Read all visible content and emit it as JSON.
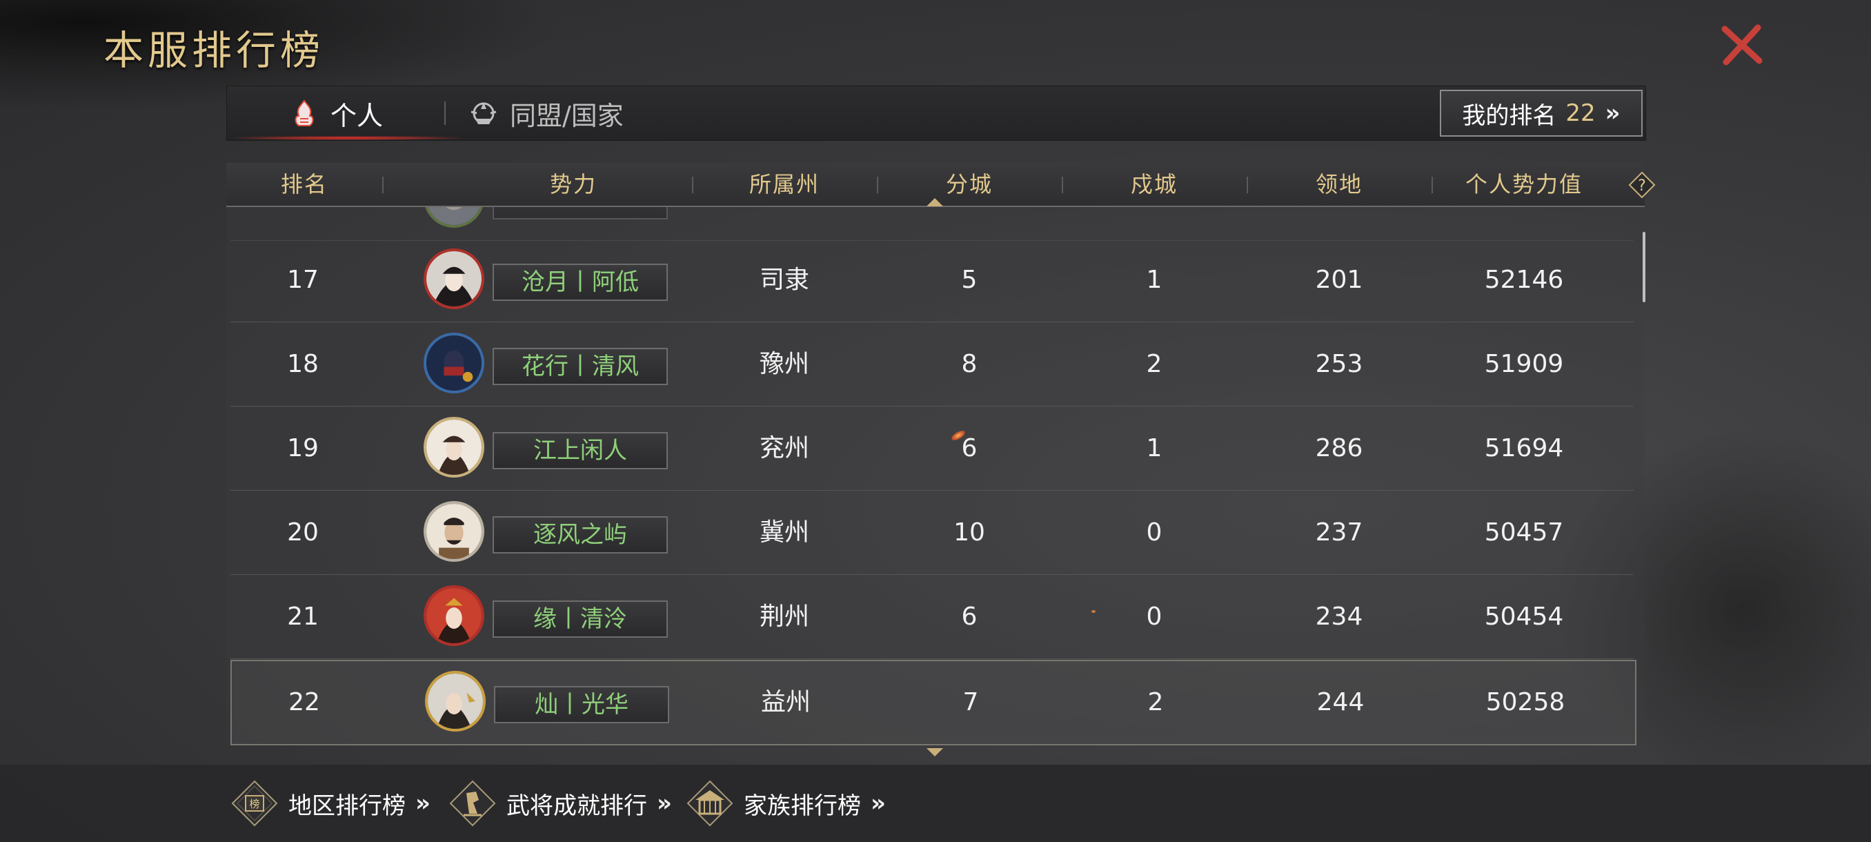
{
  "page": {
    "title": "本服排行榜"
  },
  "tabs": [
    {
      "label": "个人",
      "icon": "personal-flame-icon",
      "active": true
    },
    {
      "label": "同盟/国家",
      "icon": "alliance-emblem-icon",
      "active": false
    }
  ],
  "my_rank": {
    "label": "我的排名",
    "value": "22",
    "chevron": "»"
  },
  "table": {
    "columns": [
      "排名",
      "势力",
      "所属州",
      "分城",
      "戍城",
      "领地",
      "个人势力值"
    ],
    "rows": [
      {
        "rank": "17",
        "name": "沧月丨阿低",
        "state": "司隶",
        "sub_cities": "5",
        "garrisons": "1",
        "territory": "201",
        "power": "52146"
      },
      {
        "rank": "18",
        "name": "花行丨清风",
        "state": "豫州",
        "sub_cities": "8",
        "garrisons": "2",
        "territory": "253",
        "power": "51909"
      },
      {
        "rank": "19",
        "name": "江上闲人",
        "state": "兖州",
        "sub_cities": "6",
        "garrisons": "1",
        "territory": "286",
        "power": "51694"
      },
      {
        "rank": "20",
        "name": "逐风之屿",
        "state": "冀州",
        "sub_cities": "10",
        "garrisons": "0",
        "territory": "237",
        "power": "50457"
      },
      {
        "rank": "21",
        "name": "缘丨清泠",
        "state": "荆州",
        "sub_cities": "6",
        "garrisons": "0",
        "territory": "234",
        "power": "50454"
      },
      {
        "rank": "22",
        "name": "灿丨光华",
        "state": "益州",
        "sub_cities": "7",
        "garrisons": "2",
        "territory": "244",
        "power": "50258",
        "is_me": true
      }
    ]
  },
  "bottom_links": [
    {
      "label": "地区排行榜",
      "icon": "region-rank-icon",
      "chevron": "»"
    },
    {
      "label": "武将成就排行",
      "icon": "general-achievement-icon",
      "chevron": "»"
    },
    {
      "label": "家族排行榜",
      "icon": "clan-hall-icon",
      "chevron": "»"
    }
  ],
  "colors": {
    "gold": "#e2c98d",
    "name_green": "#8fd07a",
    "close_red": "#c8403a"
  }
}
